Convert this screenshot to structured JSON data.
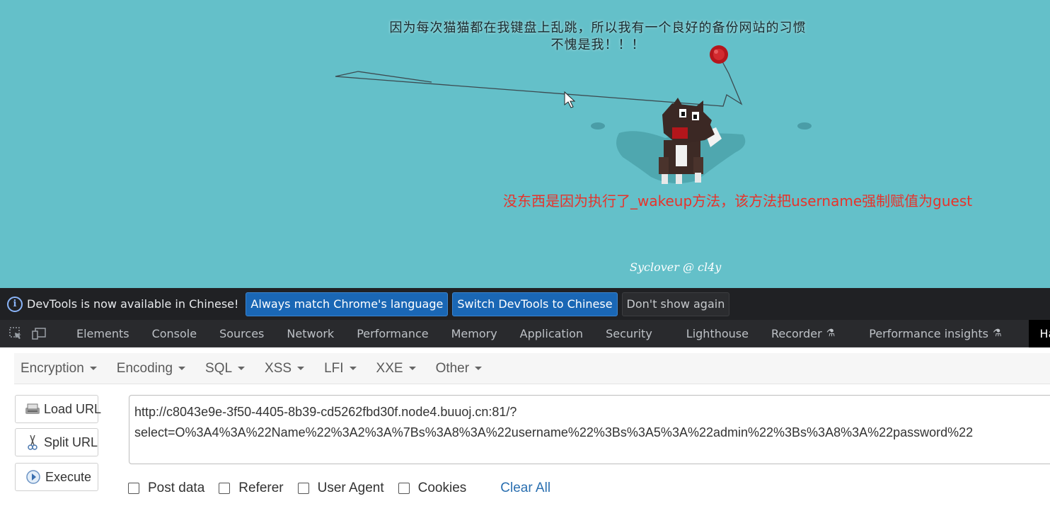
{
  "page": {
    "headline_line1": "因为每次猫猫都在我键盘上乱跳，所以我有一个良好的备份网站的习惯",
    "headline_line2": "不愧是我！！！",
    "annotation": "没东西是因为执行了_wakeup方法，该方法把username强制赋值为guest",
    "credit": "Syclover @ cl4y",
    "bg_color": "#64c0c9",
    "annotation_color": "#e8322a"
  },
  "infobar": {
    "message": "DevTools is now available in Chinese!",
    "btn_match": "Always match Chrome's language",
    "btn_switch": "Switch DevTools to Chinese",
    "btn_dismiss": "Don't show again"
  },
  "devtools": {
    "tabs": [
      "Elements",
      "Console",
      "Sources",
      "Network",
      "Performance",
      "Memory",
      "Application",
      "Security",
      "Lighthouse",
      "Recorder",
      "Performance insights",
      "HackBar"
    ],
    "active_tab": "HackBar"
  },
  "hackbar": {
    "menu": [
      "Encryption",
      "Encoding",
      "SQL",
      "XSS",
      "LFI",
      "XXE",
      "Other"
    ],
    "load_url": "Load URL",
    "split_url": "Split URL",
    "execute": "Execute",
    "url_line1": "http://c8043e9e-3f50-4405-8b39-cd5262fbd30f.node4.buuoj.cn:81/?",
    "url_line2": "select=O%3A4%3A%22Name%22%3A2%3A%7Bs%3A8%3A%22username%22%3Bs%3A5%3A%22admin%22%3Bs%3A8%3A%22password%22",
    "opt_post": "Post data",
    "opt_referer": "Referer",
    "opt_ua": "User Agent",
    "opt_cookies": "Cookies",
    "clear_all": "Clear All"
  }
}
